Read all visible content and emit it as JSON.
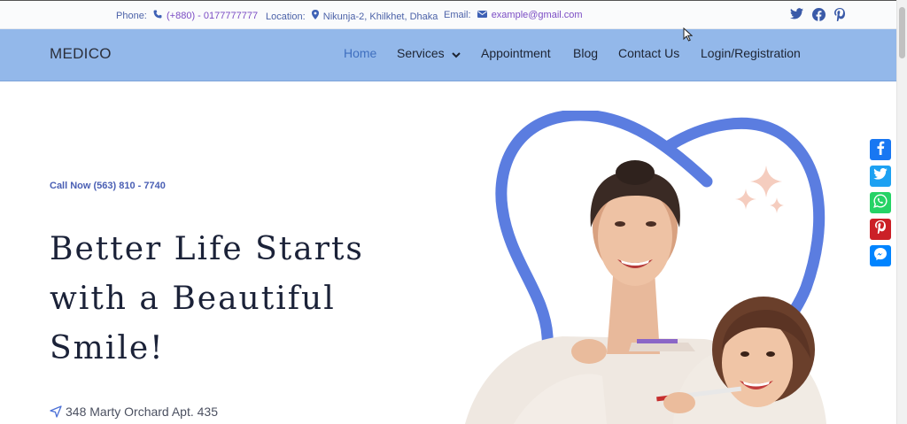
{
  "topbar": {
    "phone_label": "Phone:",
    "phone_value": "(+880) - 0177777777",
    "location_label": "Location:",
    "location_value": "Nikunja-2, Khilkhet, Dhaka",
    "email_label": "Email:",
    "email_value": "example@gmail.com",
    "social_icons": [
      "twitter-icon",
      "facebook-icon",
      "pinterest-icon"
    ]
  },
  "navbar": {
    "brand": "MEDICO",
    "links": [
      {
        "label": "Home",
        "active": true
      },
      {
        "label": "Services",
        "has_dropdown": true
      },
      {
        "label": "Appointment"
      },
      {
        "label": "Blog"
      },
      {
        "label": "Contact Us"
      },
      {
        "label": "Login/Registration"
      }
    ]
  },
  "hero": {
    "call_now": "Call Now (563) 810 - 7740",
    "headline_line1": "Better Life Starts",
    "headline_line2": "with a Beautiful",
    "headline_line3": "Smile!",
    "address": "348 Marty Orchard Apt. 435"
  },
  "share_bar": [
    {
      "icon": "facebook-share-icon",
      "color": "#1877f2"
    },
    {
      "icon": "twitter-share-icon",
      "color": "#1da1f2"
    },
    {
      "icon": "whatsapp-share-icon",
      "color": "#25d366"
    },
    {
      "icon": "pinterest-share-icon",
      "color": "#cb2027"
    },
    {
      "icon": "messenger-share-icon",
      "color": "#0084ff"
    }
  ],
  "colors": {
    "nav_bg": "#93b8ea",
    "accent": "#4a6fd6",
    "headline": "#1b2238"
  }
}
